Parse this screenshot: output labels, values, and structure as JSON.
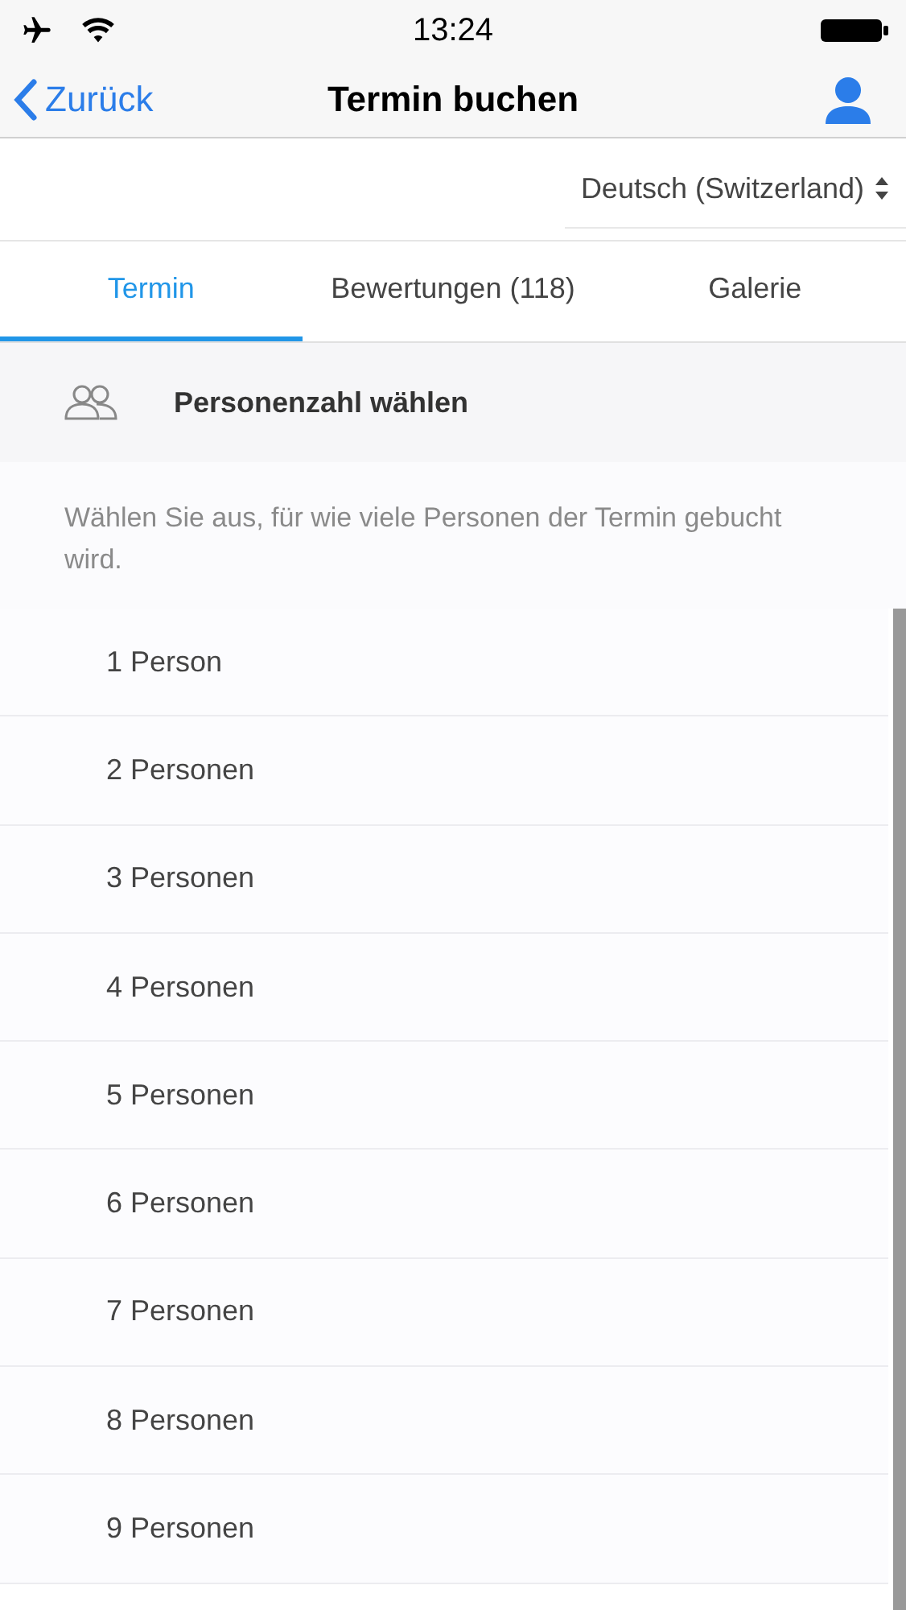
{
  "status_bar": {
    "time": "13:24"
  },
  "nav": {
    "back": "Zurück",
    "title": "Termin buchen"
  },
  "language": {
    "value": "Deutsch (Switzerland)"
  },
  "tabs": [
    {
      "label": "Termin",
      "selected": true
    },
    {
      "label": "Bewertungen (118)",
      "selected": false
    },
    {
      "label": "Galerie",
      "selected": false
    }
  ],
  "section": {
    "title": "Personenzahl wählen",
    "description": "Wählen Sie aus, für wie viele Personen der Termin gebucht wird."
  },
  "options": [
    "1 Person",
    "2 Personen",
    "3 Personen",
    "4 Personen",
    "5 Personen",
    "6 Personen",
    "7 Personen",
    "8 Personen",
    "9 Personen"
  ]
}
